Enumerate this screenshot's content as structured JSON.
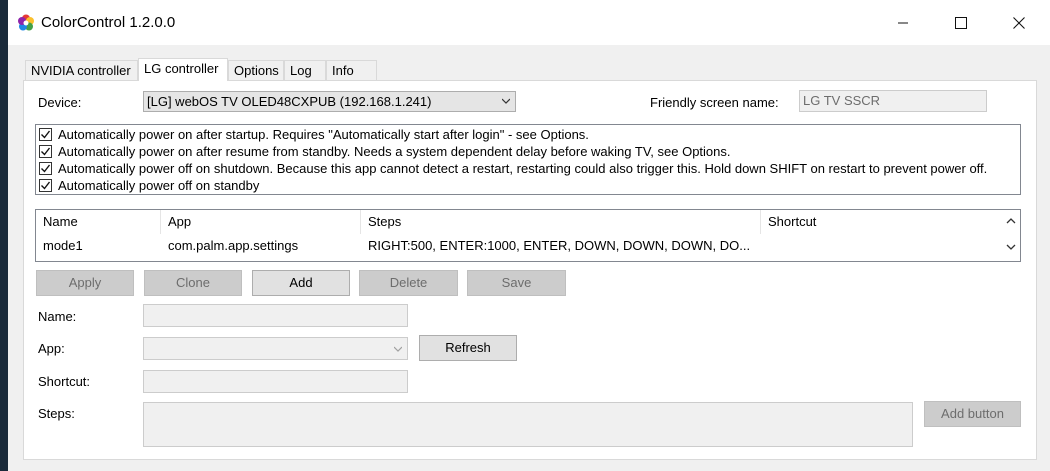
{
  "window": {
    "title": "ColorControl 1.2.0.0"
  },
  "tabs": [
    {
      "label": "NVIDIA controller"
    },
    {
      "label": "LG controller"
    },
    {
      "label": "Options"
    },
    {
      "label": "Log"
    },
    {
      "label": "Info"
    }
  ],
  "device": {
    "label": "Device:",
    "value": "[LG] webOS TV OLED48CXPUB (192.168.1.241)"
  },
  "friendly": {
    "label": "Friendly screen name:",
    "value": "LG TV SSCR"
  },
  "options": [
    {
      "label": "Automatically power on after startup. Requires \"Automatically start after login\" - see Options.",
      "checked": true
    },
    {
      "label": "Automatically power on after resume from standby. Needs a system dependent delay before waking TV, see Options.",
      "checked": true
    },
    {
      "label": "Automatically power off on shutdown. Because this app cannot detect a restart, restarting could also trigger this. Hold down SHIFT on restart to prevent power off.",
      "checked": true
    },
    {
      "label": "Automatically power off on standby",
      "checked": true
    }
  ],
  "table": {
    "columns": [
      "Name",
      "App",
      "Steps",
      "Shortcut"
    ],
    "rows": [
      {
        "name": "mode1",
        "app": "com.palm.app.settings",
        "steps": "RIGHT:500, ENTER:1000, ENTER, DOWN, DOWN, DOWN, DO...",
        "shortcut": ""
      }
    ]
  },
  "buttons": {
    "apply": "Apply",
    "clone": "Clone",
    "add": "Add",
    "delete": "Delete",
    "save": "Save",
    "refresh": "Refresh",
    "add_button": "Add button"
  },
  "form": {
    "name_label": "Name:",
    "app_label": "App:",
    "shortcut_label": "Shortcut:",
    "steps_label": "Steps:",
    "name_value": "",
    "app_value": "",
    "shortcut_value": ""
  },
  "icons": {
    "app": "color-wheel-icon",
    "minimize": "minimize-icon",
    "maximize": "maximize-icon",
    "close": "close-icon",
    "dropdown": "chevron-down-icon",
    "scroll_up": "chevron-up-icon",
    "scroll_down": "chevron-down-icon",
    "check": "checkmark-icon"
  }
}
